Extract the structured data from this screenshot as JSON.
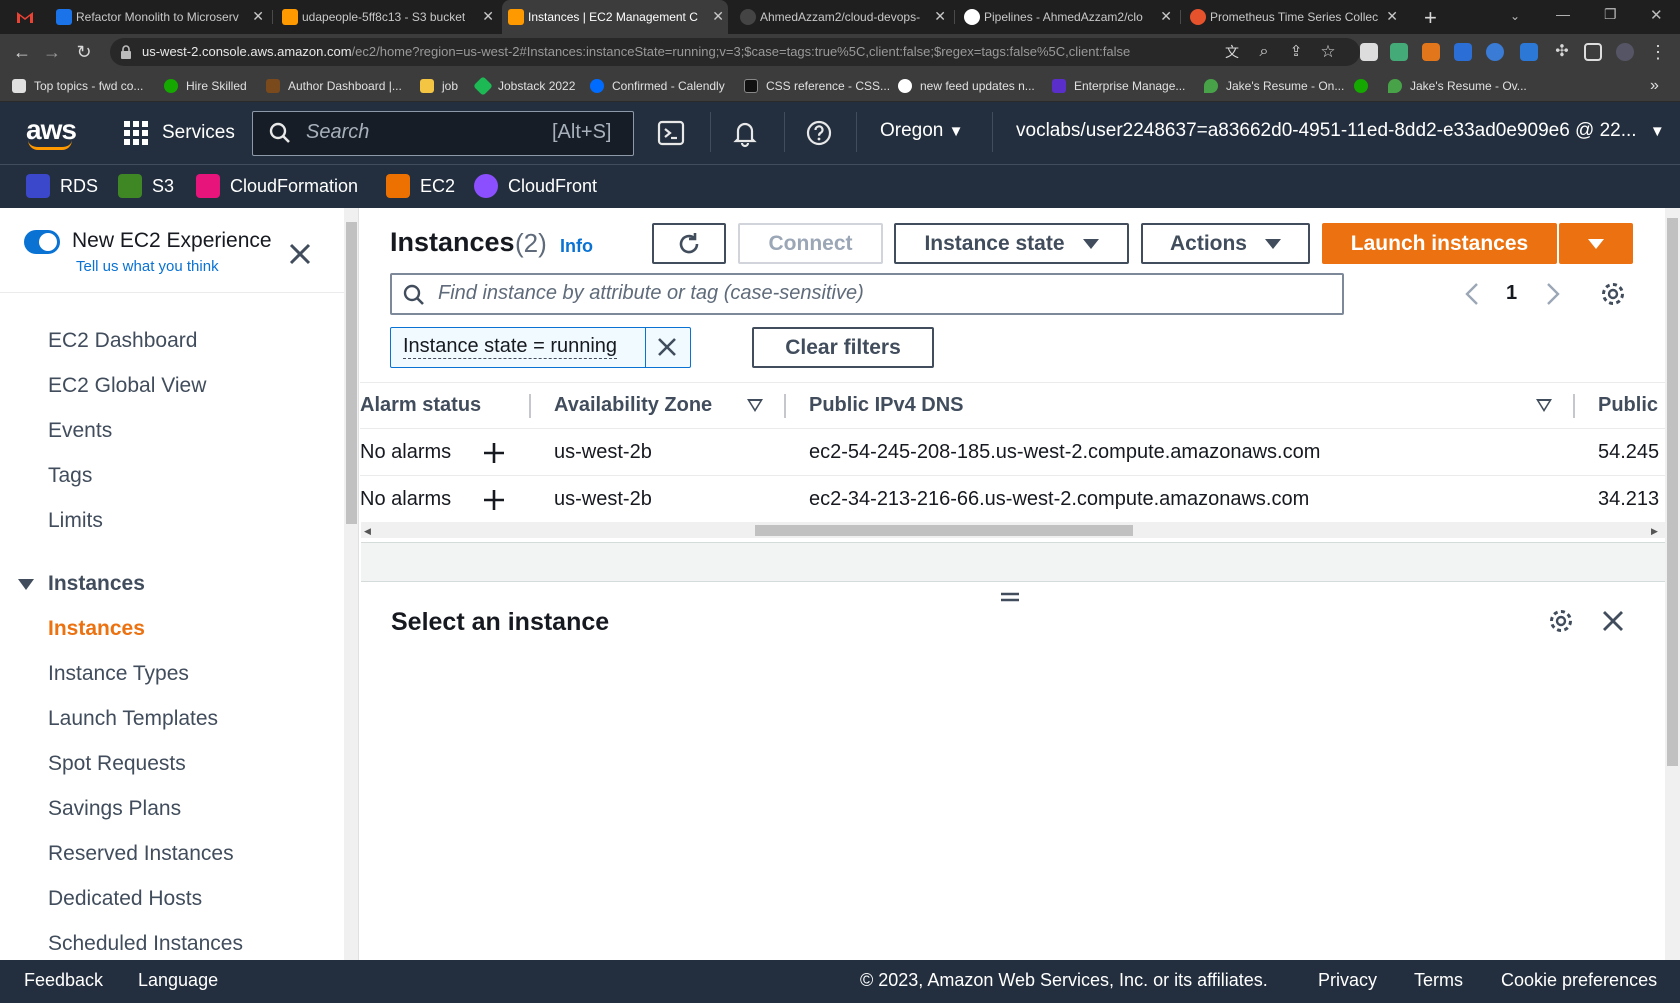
{
  "browser": {
    "tabs": [
      {
        "label": "Refactor Monolith to Microserv",
        "favicon_color": "#d93025"
      },
      {
        "label": "udapeople-5ff8c13 - S3 bucket",
        "favicon_color": "#ff9900"
      },
      {
        "label": "Instances | EC2 Management C",
        "favicon_color": "#ff9900",
        "active": true
      },
      {
        "label": "AhmedAzzam2/cloud-devops-",
        "favicon_color": "#444444"
      },
      {
        "label": "Pipelines - AhmedAzzam2/clo",
        "favicon_color": "#ffffff"
      },
      {
        "label": "Prometheus Time Series Collec",
        "favicon_color": "#e6522c"
      }
    ],
    "url_host": "us-west-2.console.aws.amazon.com",
    "url_path": "/ec2/home?region=us-west-2#Instances:instanceState=running;v=3;$case=tags:true%5C,client:false;$regex=tags:false%5C,client:false",
    "bookmarks": [
      {
        "label": "Top topics - fwd co...",
        "color": "#e0e0e0"
      },
      {
        "label": "Hire Skilled",
        "color": "#14a800"
      },
      {
        "label": "Author Dashboard |...",
        "color": "#7a4a1d"
      },
      {
        "label": "job",
        "color": "#f4c542"
      },
      {
        "label": "Jobstack 2022",
        "color": "#1db954"
      },
      {
        "label": "Confirmed - Calendly",
        "color": "#006bff"
      },
      {
        "label": "CSS reference - CSS...",
        "color": "#111111"
      },
      {
        "label": "new feed updates n...",
        "color": "#ffffff"
      },
      {
        "label": "Enterprise Manage...",
        "color": "#5a2ec9"
      },
      {
        "label": "Jake's Resume - On...",
        "color": "#47a248"
      },
      {
        "label": "",
        "color": "#14a800"
      },
      {
        "label": "Jake's Resume - Ov...",
        "color": "#47a248"
      }
    ],
    "bookmarks_more": "»"
  },
  "aws_header": {
    "logo": "aws",
    "services_label": "Services",
    "search_placeholder": "Search",
    "search_shortcut": "[Alt+S]",
    "region": "Oregon",
    "account": "voclabs/user2248637=a83662d0-4951-11ed-8dd2-e33ad0e909e6 @ 22...",
    "favorites": [
      {
        "label": "RDS",
        "color": "#3b48cc"
      },
      {
        "label": "S3",
        "color": "#3f8624"
      },
      {
        "label": "CloudFormation",
        "color": "#e7157b"
      },
      {
        "label": "EC2",
        "color": "#ed7100"
      },
      {
        "label": "CloudFront",
        "color": "#8c4fff"
      }
    ]
  },
  "sidebar": {
    "new_experience_label": "New EC2 Experience",
    "tell_us_label": "Tell us what you think",
    "top_items": [
      "EC2 Dashboard",
      "EC2 Global View",
      "Events",
      "Tags",
      "Limits"
    ],
    "section_label": "Instances",
    "section_items": [
      "Instances",
      "Instance Types",
      "Launch Templates",
      "Spot Requests",
      "Savings Plans",
      "Reserved Instances",
      "Dedicated Hosts",
      "Scheduled Instances"
    ],
    "active_item": "Instances"
  },
  "main": {
    "title": "Instances",
    "count": "(2)",
    "info_label": "Info",
    "connect_label": "Connect",
    "instance_state_label": "Instance state",
    "actions_label": "Actions",
    "launch_label": "Launch instances",
    "find_placeholder": "Find instance by attribute or tag (case-sensitive)",
    "page_number": "1",
    "filter_token": "Instance state = running",
    "clear_filters_label": "Clear filters",
    "columns": [
      "Alarm status",
      "Availability Zone",
      "Public IPv4 DNS",
      "Public"
    ],
    "rows": [
      {
        "alarm": "No alarms",
        "az": "us-west-2b",
        "dns": "ec2-54-245-208-185.us-west-2.compute.amazonaws.com",
        "ip": "54.245"
      },
      {
        "alarm": "No alarms",
        "az": "us-west-2b",
        "dns": "ec2-34-213-216-66.us-west-2.compute.amazonaws.com",
        "ip": "34.213"
      }
    ],
    "details_title": "Select an instance"
  },
  "footer": {
    "feedback": "Feedback",
    "language": "Language",
    "copyright": "© 2023, Amazon Web Services, Inc. or its affiliates.",
    "privacy": "Privacy",
    "terms": "Terms",
    "cookies": "Cookie preferences"
  },
  "colors": {
    "aws_nav": "#232f3e",
    "accent_orange": "#ec7211",
    "link_blue": "#0972d3"
  }
}
